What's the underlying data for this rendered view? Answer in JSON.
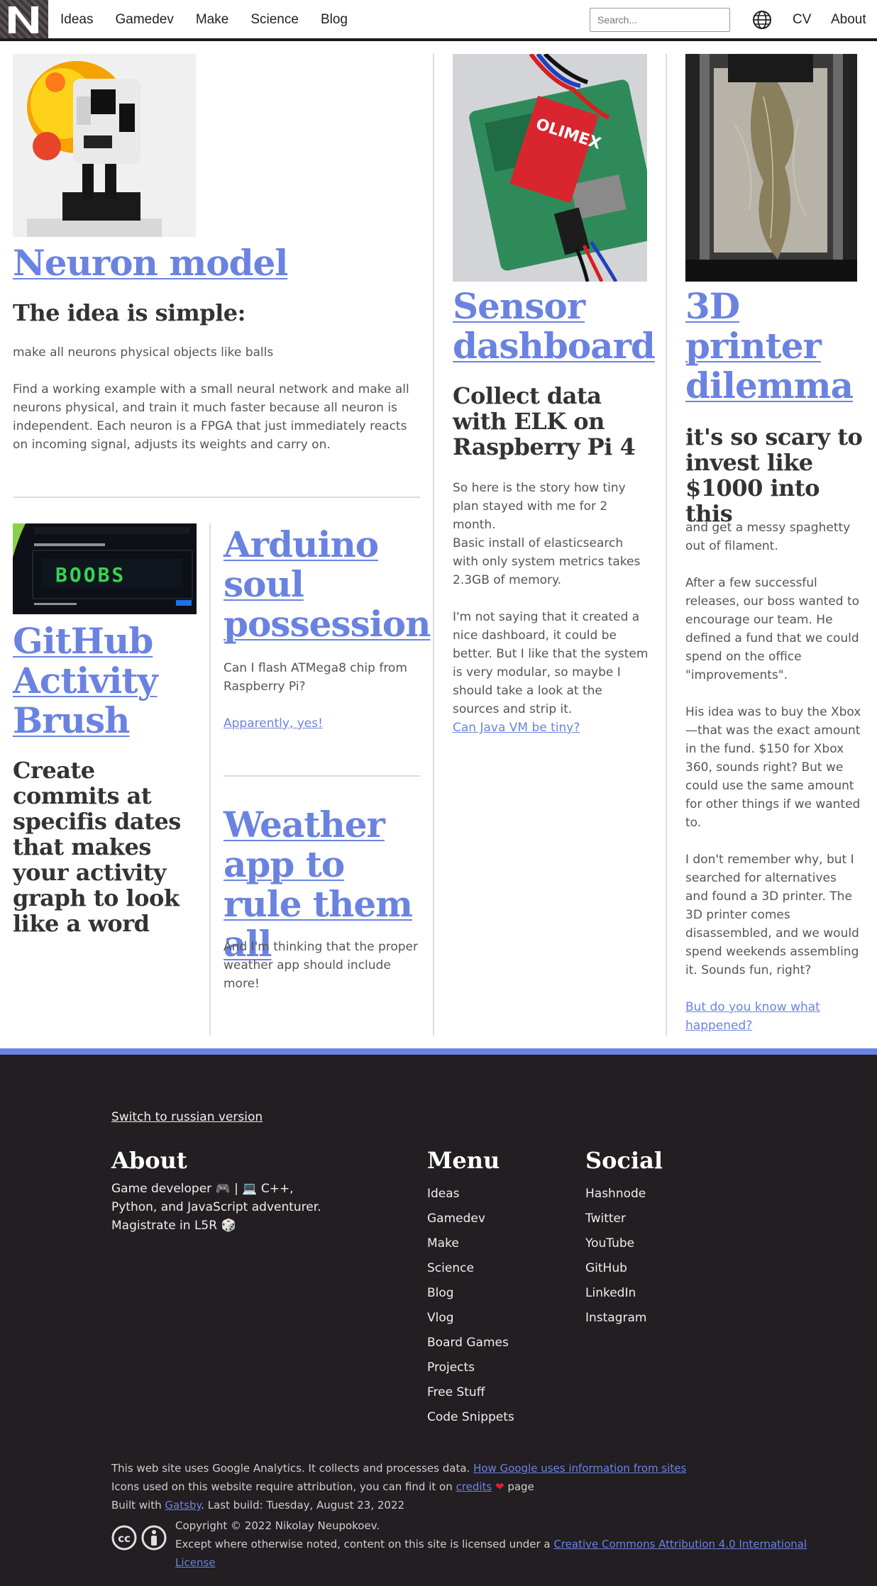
{
  "header": {
    "nav": [
      "Ideas",
      "Gamedev",
      "Make",
      "Science",
      "Blog"
    ],
    "search_placeholder": "Search...",
    "cv": "CV",
    "about": "About"
  },
  "posts": {
    "neuron": {
      "title": "Neuron model",
      "subtitle": "The idea is simple:",
      "p1": "make all neurons physical objects like balls",
      "p2": "Find a working example with a small neural network and make all neurons physical, and train it much faster because all neuron is independent. Each neuron is a FPGA that just immediately reacts on incoming signal, adjusts its weights and carry on."
    },
    "sensor": {
      "title": "Sensor dashboard",
      "subtitle": "Collect data with ELK on Raspberry Pi 4",
      "p1": "So here is the story how tiny plan stayed with me for 2 month.",
      "p2": "Basic install of elasticsearch with only system metrics takes 2.3GB of memory.",
      "p3": "I'm not saying that it created a nice dashboard, it could be better. But I like that the system is very modular, so maybe I should take a look at the sources and strip it.",
      "link": "Can Java VM be tiny?",
      "board_text": "OLIMEX"
    },
    "printer": {
      "title": "3D printer dilemma",
      "subtitle": "it's so scary to invest like $1000 into this",
      "p1": "and get a messy spaghetty out of filament.",
      "p2": "After a few successful releases, our boss wanted to encourage our team. He defined a fund that we could spend on the office \"improvements\".",
      "p3": "His idea was to buy the Xbox—that was the exact amount in the fund. $150 for Xbox 360, sounds right? But we could use the same amount for other things if we wanted to.",
      "p4": "I don't remember why, but I searched for alternatives and found a 3D printer. The 3D printer comes disassembled, and we would spend weekends assembling it. Sounds fun, right?",
      "link": "But do you know what happened?"
    },
    "github": {
      "title": "GitHub Activity Brush",
      "subtitle": "Create commits at specifis dates that makes your activity graph to look like a word",
      "graph_word": "BOOBS"
    },
    "arduino": {
      "title": "Arduino soul possession",
      "p1": "Can I flash ATMega8 chip from Raspberry Pi?",
      "link": "Apparently, yes!"
    },
    "weather": {
      "title": "Weather app to rule them all",
      "p1": "And I'm thinking that the proper weather app should include more!"
    }
  },
  "footer": {
    "switch": "Switch to russian version",
    "about_title": "About",
    "about_text": "Game developer 🎮 | 💻 C++, Python, and JavaScript adventurer. Magistrate in L5R 🎲",
    "menu_title": "Menu",
    "menu": [
      "Ideas",
      "Gamedev",
      "Make",
      "Science",
      "Blog",
      "Vlog",
      "Board Games",
      "Projects",
      "Free Stuff",
      "Code Snippets"
    ],
    "social_title": "Social",
    "social": [
      "Hashnode",
      "Twitter",
      "YouTube",
      "GitHub",
      "LinkedIn",
      "Instagram"
    ],
    "analytics_text": "This web site uses Google Analytics. It collects and processes data.",
    "analytics_link": "How Google uses information from sites",
    "icons_text": "Icons used on this website require attribution, you can find it on",
    "icons_link": "credits",
    "icons_after": "page",
    "built_text": "Built with",
    "built_link": "Gatsby",
    "built_after": ". Last build: Tuesday, August 23, 2022",
    "copyright": "Copyright © 2022 Nikolay Neupokoev.",
    "license_text": "Except where otherwise noted, content on this site is licensed under a",
    "license_link_1": "Creative Commons Attribution 4.0 International",
    "license_link_2": "License"
  },
  "colors": {
    "accent": "#6b83e0",
    "footer_bg": "#221e21",
    "text": "#333333",
    "heart": "#e0202e"
  }
}
